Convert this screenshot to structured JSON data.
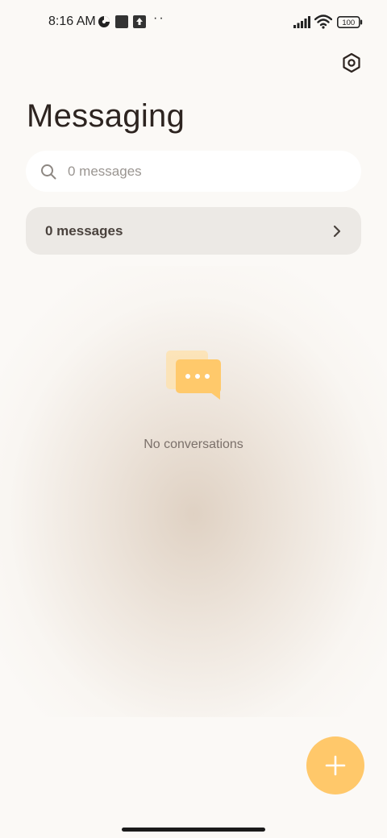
{
  "status_bar": {
    "time": "8:16 AM",
    "dots": "··",
    "battery": "100",
    "icons": [
      "data-saver-icon",
      "notification-square-icon",
      "upload-icon",
      "signal-icon",
      "wifi-icon",
      "battery-icon"
    ]
  },
  "header": {
    "title": "Messaging",
    "settings_icon": "settings-hexagon-icon"
  },
  "search": {
    "placeholder": "0 messages",
    "value": ""
  },
  "messages_row": {
    "label": "0 messages"
  },
  "empty_state": {
    "text": "No conversations",
    "icon": "chat-bubbles-icon"
  },
  "fab": {
    "icon": "plus-icon"
  },
  "colors": {
    "accent": "#ffc86a",
    "background": "#fbf9f6",
    "title": "#2d2420",
    "row_background": "#ece9e5"
  }
}
